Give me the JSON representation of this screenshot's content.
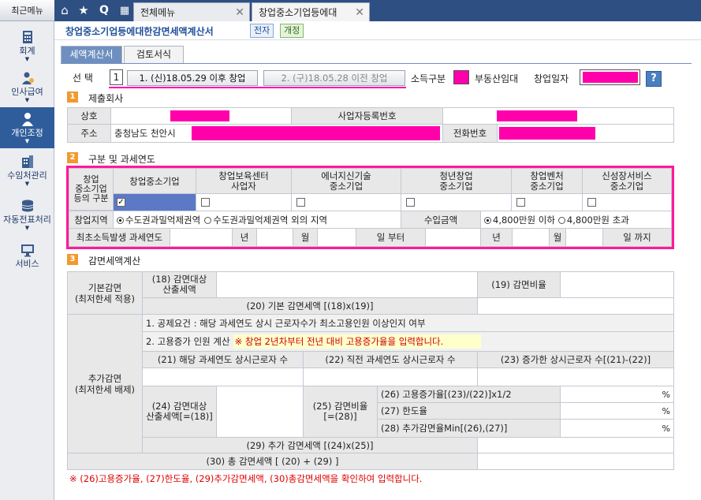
{
  "sidebar": {
    "recent": "최근메뉴",
    "items": [
      {
        "label": "회계",
        "icon": "calculator-icon"
      },
      {
        "label": "인사급여",
        "icon": "person-coin-icon"
      },
      {
        "label": "개인조정",
        "icon": "person-icon"
      },
      {
        "label": "수임처관리",
        "icon": "building-icon"
      },
      {
        "label": "자동전표처리",
        "icon": "database-icon"
      },
      {
        "label": "서비스",
        "icon": "monitor-icon"
      }
    ]
  },
  "topbar": {
    "icons": [
      "home-icon",
      "star-icon",
      "search-icon",
      "grid-icon"
    ],
    "tabs": [
      {
        "label": "전체메뉴"
      },
      {
        "label": "창업중소기업등에대"
      }
    ]
  },
  "title": {
    "text": "창업중소기업등에대한감면세액계산서",
    "btn1": "전자",
    "btn2": "개정"
  },
  "subtabs": [
    "세액계산서",
    "검토서식"
  ],
  "select": {
    "label": "선   택",
    "value": "1",
    "opt1": "1. (신)18.05.29 이후 창업",
    "opt2": "2. (구)18.05.28 이전 창업",
    "income_label": "소득구분",
    "real_estate": "부동산임대",
    "startup_date": "창업일자",
    "help": "?"
  },
  "sec1": {
    "num": "1",
    "title": "제출회사",
    "company": "상호",
    "bizno": "사업자등록번호",
    "address": "주소",
    "address_value": "충청남도 천안시",
    "phone": "전화번호"
  },
  "sec2": {
    "num": "2",
    "title": "구분 및 과세연도",
    "type_label": "창업\n중소기업\n등의 구분",
    "cols": [
      "창업중소기업",
      "창업보육센터\n사업자",
      "에너지신기술\n중소기업",
      "청년창업\n중소기업",
      "창업벤처\n중소기업",
      "신성장서비스\n중소기업"
    ],
    "region_label": "창업지역",
    "region_opt1": "수도권과밀억제권역",
    "region_opt2": "수도권과밀억제권역 외의 지역",
    "income_label": "수입금액",
    "income_opt1": "4,800만원 이하",
    "income_opt2": "4,800만원 초과",
    "first_year": "최초소득발생 과세연도",
    "y": "년",
    "m": "월",
    "d_from": "일 부터",
    "d_to": "일 까지"
  },
  "sec3": {
    "num": "3",
    "title": "감면세액계산",
    "basic": "기본감면\n(최저한세 적용)",
    "r18": "(18) 감면대상\n산출세액",
    "r19": "(19) 감면비율",
    "r20": "(20) 기본 감면세액 [(18)x(19)]",
    "extra": "추가감면\n(최저한세 배제)",
    "line1": "1. 공제요건 : 해당 과세연도 상시 근로자수가 최소고용인원 이상인지 여부",
    "line2": "2. 고용증가 인원 계산",
    "line2_note": "※ 창업 2년차부터 전년 대비 고용증가율을 입력합니다.",
    "r21": "(21) 해당 과세연도 상시근로자 수",
    "r22": "(22) 직전 과세연도 상시근로자 수",
    "r23": "(23) 증가한 상시근로자 수[(21)-(22)]",
    "r24": "(24) 감면대상\n산출세액[=(18)]",
    "r25": "(25) 감면비율\n[=(28)]",
    "r26": "(26) 고용증가율[(23)/(22)]x1/2",
    "r27": "(27) 한도율",
    "r28": "(28) 추가감면율Min[(26),(27)]",
    "pct": "%",
    "r29": "(29) 추가 감면세액 [(24)x(25)]",
    "r30": "(30) 총 감면세액 [ (20) + (29) ]",
    "footer": "※ (26)고용증가율, (27)한도율, (29)추가감면세액, (30)총감면세액을 확인하여 입력합니다."
  }
}
